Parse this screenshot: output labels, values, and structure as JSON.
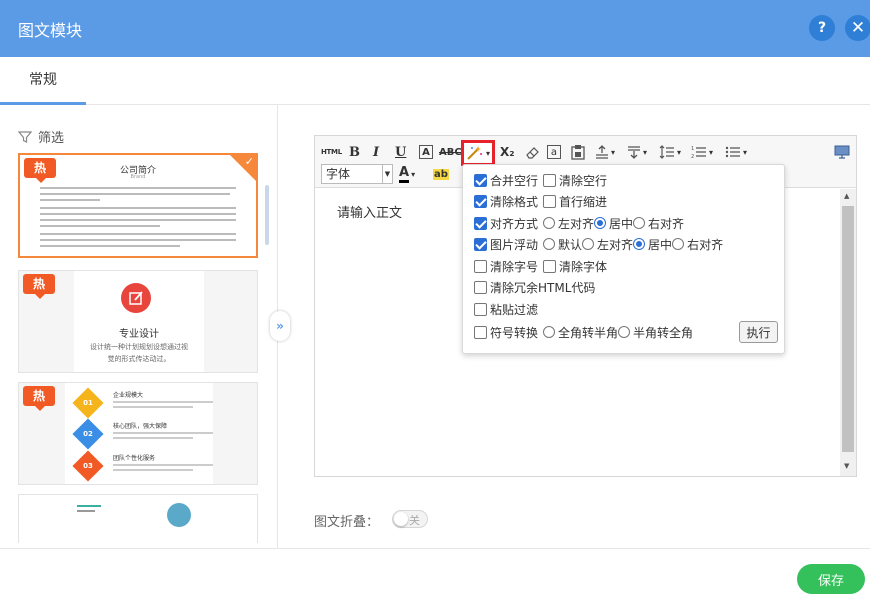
{
  "header": {
    "title": "图文模块",
    "help": "?",
    "close": "✕"
  },
  "tabs": [
    {
      "label": "常规"
    }
  ],
  "filter": {
    "label": "筛选"
  },
  "cards": [
    {
      "badge": "热",
      "title": "公司简介",
      "subtitle": "Brand"
    },
    {
      "badge": "热",
      "title": "专业设计",
      "line1": "设计统一种计划规划设想通过视",
      "line2": "觉的形式传达动过。"
    },
    {
      "badge": "热",
      "items": [
        {
          "num": "01",
          "title": "企业规模大"
        },
        {
          "num": "02",
          "title": "核心团队，强大保障"
        },
        {
          "num": "03",
          "title": "团队个性化服务"
        }
      ]
    }
  ],
  "editor": {
    "toolbar": {
      "html": "HTML",
      "bold": "B",
      "italic": "I",
      "underline": "U",
      "font_box": "A",
      "strike": "ABC",
      "subscript": "X₂",
      "at": "a",
      "font_family": "字体",
      "font_color": "A",
      "highlight": "ab"
    },
    "placeholder": "请输入正文"
  },
  "popup": {
    "merge_empty": "合并空行",
    "clear_empty": "清除空行",
    "clear_format": "清除格式",
    "indent_first": "首行缩进",
    "align": "对齐方式",
    "align_left": "左对齐",
    "align_center": "居中",
    "align_right": "右对齐",
    "img_float": "图片浮动",
    "float_default": "默认",
    "float_left": "左对齐",
    "float_center": "居中",
    "float_right": "右对齐",
    "clear_size": "清除字号",
    "clear_font": "清除字体",
    "clear_html": "清除冗余HTML代码",
    "paste_filter": "粘贴过滤",
    "symbol_convert": "符号转换",
    "full_to_half": "全角转半角",
    "half_to_full": "半角转全角",
    "exec": "执行"
  },
  "fold": {
    "label": "图文折叠：",
    "state": "关"
  },
  "footer": {
    "save": "保存"
  },
  "colors": {
    "header": "#5b9be6",
    "accent": "#2b6fd6",
    "save": "#34c05a",
    "hot": "#f15a24"
  }
}
